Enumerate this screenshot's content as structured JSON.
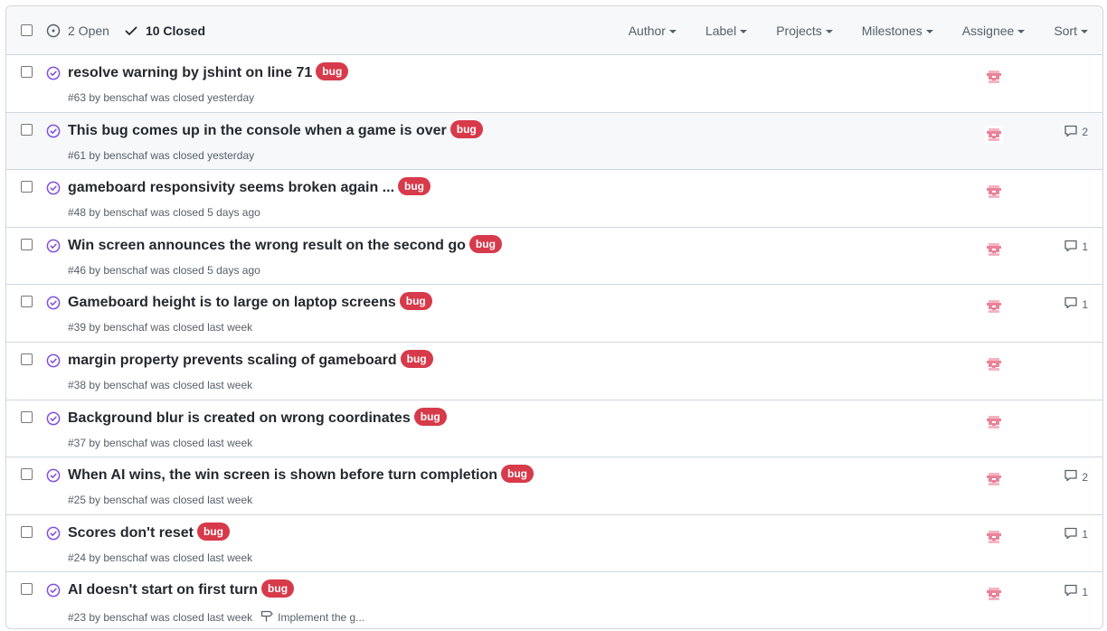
{
  "header": {
    "open_label": "2 Open",
    "closed_label": "10 Closed",
    "filters": [
      "Author",
      "Label",
      "Projects",
      "Milestones",
      "Assignee",
      "Sort"
    ]
  },
  "colors": {
    "label_bug": "#d73a4a",
    "closed_icon": "#8250df"
  },
  "issues": [
    {
      "title": "resolve warning by jshint on line 71",
      "label": "bug",
      "meta": "#63 by benschaf was closed yesterday",
      "comments": ""
    },
    {
      "title": "This bug comes up in the console when a game is over",
      "label": "bug",
      "meta": "#61 by benschaf was closed yesterday",
      "comments": "2"
    },
    {
      "title": "gameboard responsivity seems broken again ...",
      "label": "bug",
      "meta": "#48 by benschaf was closed 5 days ago",
      "comments": ""
    },
    {
      "title": "Win screen announces the wrong result on the second go",
      "label": "bug",
      "meta": "#46 by benschaf was closed 5 days ago",
      "comments": "1"
    },
    {
      "title": "Gameboard height is to large on laptop screens",
      "label": "bug",
      "meta": "#39 by benschaf was closed last week",
      "comments": "1"
    },
    {
      "title": "margin property prevents scaling of gameboard",
      "label": "bug",
      "meta": "#38 by benschaf was closed last week",
      "comments": ""
    },
    {
      "title": "Background blur is created on wrong coordinates",
      "label": "bug",
      "meta": "#37 by benschaf was closed last week",
      "comments": ""
    },
    {
      "title": "When AI wins, the win screen is shown before turn completion",
      "label": "bug",
      "meta": "#25 by benschaf was closed last week",
      "comments": "2"
    },
    {
      "title": "Scores don't reset",
      "label": "bug",
      "meta": "#24 by benschaf was closed last week",
      "comments": "1"
    },
    {
      "title": "AI doesn't start on first turn",
      "label": "bug",
      "meta": "#23 by benschaf was closed last week",
      "milestone": "Implement the g...",
      "comments": "1"
    }
  ]
}
